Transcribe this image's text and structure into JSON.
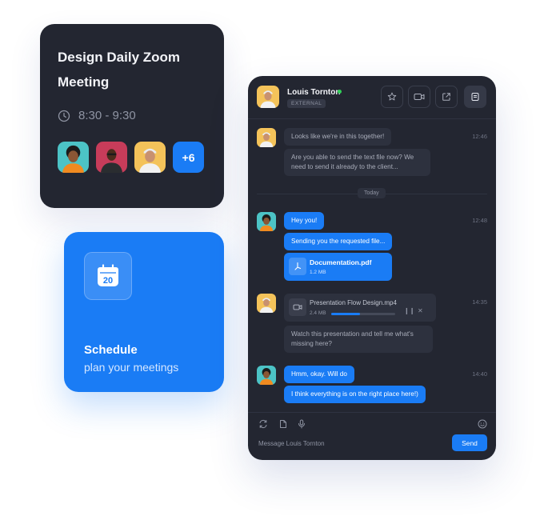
{
  "meeting": {
    "title_line1": "Design Daily Zoom",
    "title_line2": "Meeting",
    "time": "8:30 - 9:30",
    "more_count": "+6"
  },
  "schedule": {
    "calendar_day": "20",
    "title": "Schedule",
    "subtitle": "plan your meetings"
  },
  "chat": {
    "contact_name": "Louis Tornton",
    "contact_badge": "EXTERNAL",
    "divider_label": "Today",
    "messages": [
      {
        "text": "Looks like we're in this together!",
        "time": "12:46"
      },
      {
        "text": "Are you able to send the text file now? We need to send it already to the client..."
      },
      {
        "text": "Hey you!",
        "time": "12:48"
      },
      {
        "text": "Sending you the requested file..."
      },
      {
        "text": "Watch this presentation and tell me what's missing here?",
        "time": "14:35"
      },
      {
        "text": "Hmm, okay. Will do",
        "time": "14:40"
      },
      {
        "text": "I think everything is on the right place here!)"
      }
    ],
    "file": {
      "name": "Documentation.pdf",
      "size": "1.2 MB"
    },
    "video": {
      "name": "Presentation Flow Design.mp4",
      "size": "2.4 MB",
      "progress": 0.45
    },
    "composer": {
      "placeholder": "Message Louis Tornton",
      "send_label": "Send"
    }
  },
  "colors": {
    "accent": "#1a7cf5",
    "card_bg": "#232631",
    "online": "#30d158"
  }
}
